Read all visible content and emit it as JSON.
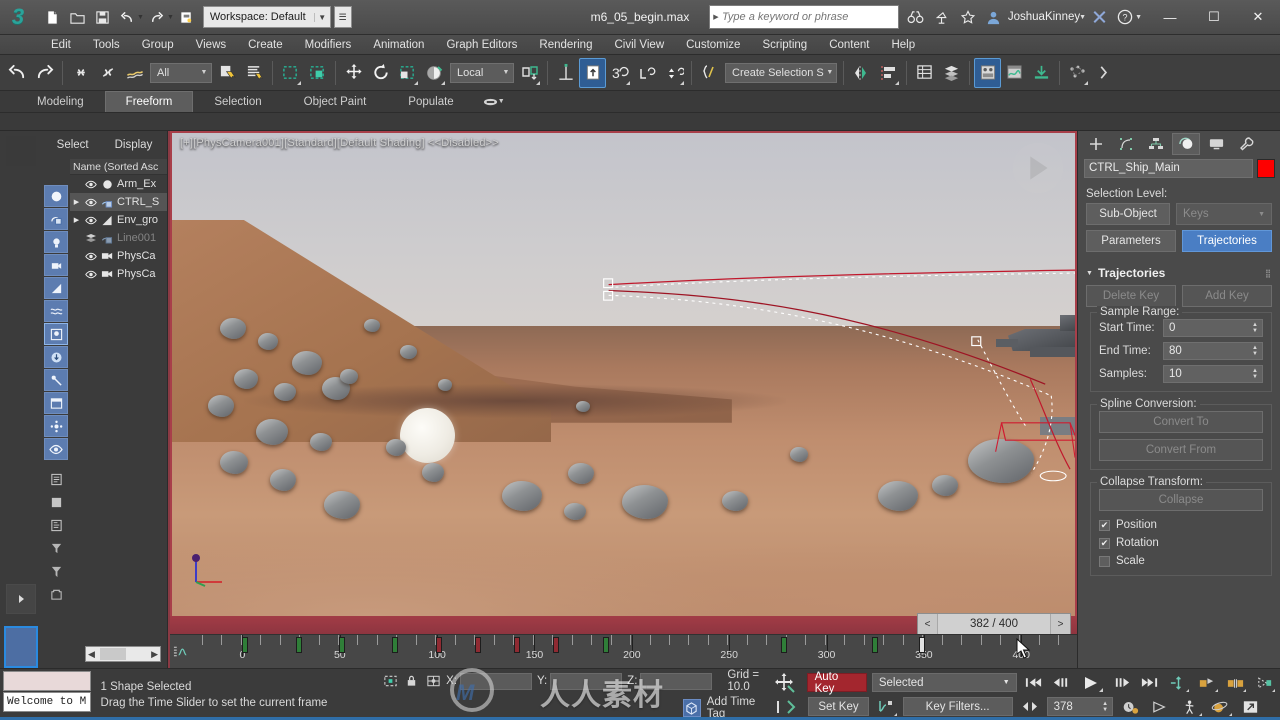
{
  "app": {
    "title": "m6_05_begin.max",
    "workspace_label": "Workspace: Default",
    "search_placeholder": "Type a keyword or phrase",
    "user_name": "JoshuaKinney"
  },
  "menu": {
    "items": [
      "Edit",
      "Tools",
      "Group",
      "Views",
      "Create",
      "Modifiers",
      "Animation",
      "Graph Editors",
      "Rendering",
      "Civil View",
      "Customize",
      "Scripting",
      "Content",
      "Help"
    ]
  },
  "toolbar": {
    "selection_filter": "All",
    "reference_coord": "Local",
    "named_selection_set": "Create Selection Se"
  },
  "ribbon": {
    "tabs": [
      "Modeling",
      "Freeform",
      "Selection",
      "Object Paint",
      "Populate"
    ],
    "selected": "Freeform"
  },
  "explorer": {
    "tabs": [
      "Select",
      "Display"
    ],
    "column_header": "Name (Sorted Asc",
    "rows": [
      {
        "name": "Arm_Ex",
        "expandable": false,
        "hidden": false,
        "selected": false,
        "icon": "sphere-icon"
      },
      {
        "name": "CTRL_S",
        "expandable": true,
        "hidden": false,
        "selected": true,
        "icon": "shape-icon"
      },
      {
        "name": "Env_gro",
        "expandable": true,
        "hidden": false,
        "selected": false,
        "icon": "geometry-icon"
      },
      {
        "name": "Line001",
        "expandable": false,
        "hidden": true,
        "selected": false,
        "icon": "shape-icon"
      },
      {
        "name": "PhysCa",
        "expandable": false,
        "hidden": false,
        "selected": false,
        "icon": "camera-icon"
      },
      {
        "name": "PhysCa",
        "expandable": false,
        "hidden": false,
        "selected": false,
        "icon": "camera-icon"
      }
    ]
  },
  "viewport": {
    "label": "[+][PhysCamera001][Standard][Default Shading]  <<Disabled>>"
  },
  "timeline": {
    "current_display": "382 / 400",
    "prev_label": "<",
    "next_label": ">",
    "ruler_labels": [
      "0",
      "50",
      "100",
      "150",
      "200",
      "250",
      "300",
      "350",
      "400"
    ],
    "range_start": 0,
    "range_end": 400,
    "keys": [
      {
        "frame": 2,
        "color": "green"
      },
      {
        "frame": 28,
        "color": "green"
      },
      {
        "frame": 50,
        "color": "green"
      },
      {
        "frame": 80,
        "color": "green"
      },
      {
        "frame": 100,
        "color": "red"
      },
      {
        "frame": 120,
        "color": "red"
      },
      {
        "frame": 140,
        "color": "red"
      },
      {
        "frame": 160,
        "color": "red"
      },
      {
        "frame": 185,
        "color": "green"
      },
      {
        "frame": 280,
        "color": "green"
      },
      {
        "frame": 318,
        "color": "green"
      },
      {
        "frame": 340,
        "color": "white"
      }
    ]
  },
  "command_panel": {
    "object_name": "CTRL_Ship_Main",
    "object_color": "#fe0000",
    "selection_level_label": "Selection Level:",
    "sub_object_label": "Sub-Object",
    "keys_label": "Keys",
    "parameters_label": "Parameters",
    "trajectories_label": "Trajectories",
    "rollup_title": "Trajectories",
    "delete_key_label": "Delete Key",
    "add_key_label": "Add Key",
    "sample_range_title": "Sample Range:",
    "start_time_label": "Start Time:",
    "start_time_value": "0",
    "end_time_label": "End Time:",
    "end_time_value": "80",
    "samples_label": "Samples:",
    "samples_value": "10",
    "spline_conversion_title": "Spline Conversion:",
    "convert_to_label": "Convert To",
    "convert_from_label": "Convert From",
    "collapse_transform_title": "Collapse Transform:",
    "collapse_label": "Collapse",
    "position_label": "Position",
    "position_checked": true,
    "rotation_label": "Rotation",
    "rotation_checked": true,
    "scale_label": "Scale",
    "scale_checked": false
  },
  "status_bar": {
    "maxscript_listener": "Welcome to M",
    "selection_status": "1 Shape Selected",
    "prompt": "Drag the Time Slider to set the current frame",
    "x_label": "X:",
    "y_label": "Y:",
    "z_label": "Z:",
    "x_value": "",
    "y_value": "",
    "z_value": "",
    "grid_text": "Grid = 10.0",
    "add_time_tag": "Add Time Tag"
  },
  "animation": {
    "auto_key_label": "Auto Key",
    "set_key_label": "Set Key",
    "key_mode_value": "Selected",
    "key_filters_label": "Key Filters...",
    "current_frame": "378"
  },
  "watermark": {
    "text": "人人素材"
  }
}
